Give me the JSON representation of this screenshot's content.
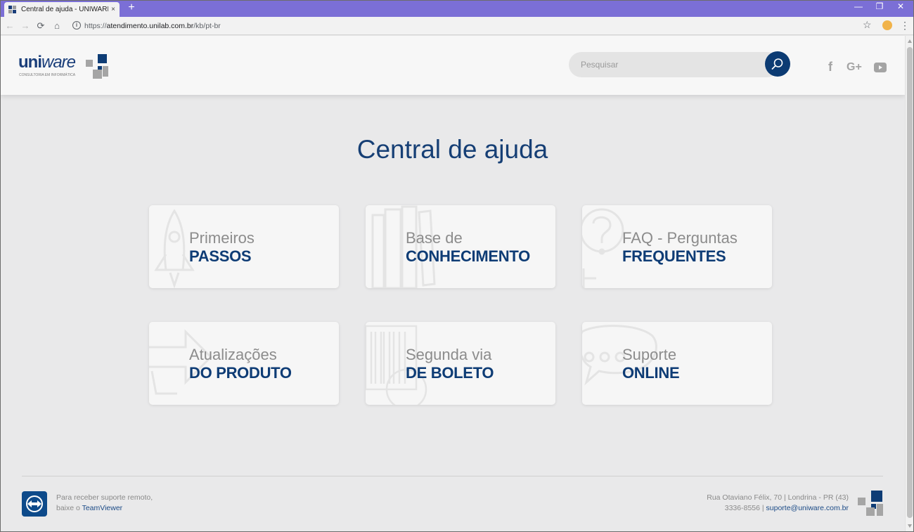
{
  "browser": {
    "tab_title": "Central de ajuda - UNIWARE CONSULTORIA",
    "tab_close": "×",
    "new_tab": "+",
    "url_prefix": "https://",
    "url_host": "atendimento.unilab.com.br",
    "url_path": "/kb/pt-br",
    "back": "←",
    "forward": "→",
    "reload": "⟳",
    "home": "⌂",
    "minimize": "—",
    "restore": "❐",
    "close": "✕",
    "bookmark": "☆",
    "menu": "⋮"
  },
  "header": {
    "logo_main": "uni",
    "logo_italic": "ware",
    "logo_tagline": "CONSULTORIA EM INFORMÁTICA",
    "search_placeholder": "Pesquisar",
    "social": [
      {
        "icon": "facebook-icon",
        "glyph": "f"
      },
      {
        "icon": "google-plus-icon",
        "glyph": "G+"
      },
      {
        "icon": "youtube-icon",
        "glyph": ""
      }
    ]
  },
  "main": {
    "title": "Central de ajuda",
    "cards": [
      {
        "line1": "Primeiros",
        "line2": "PASSOS",
        "icon": "rocket-icon"
      },
      {
        "line1": "Base de",
        "line2": "CONHECIMENTO",
        "icon": "books-icon"
      },
      {
        "line1": "FAQ - Perguntas",
        "line2": "FREQUENTES",
        "icon": "question-icon"
      },
      {
        "line1": "Atualizações",
        "line2": "DO PRODUTO",
        "icon": "arrow-icon"
      },
      {
        "line1": "Segunda via",
        "line2": "DE BOLETO",
        "icon": "barcode-icon"
      },
      {
        "line1": "Suporte",
        "line2": "ONLINE",
        "icon": "chat-icon"
      }
    ]
  },
  "footer": {
    "remote_line1": "Para receber suporte remoto,",
    "remote_line2_prefix": "baixe o ",
    "remote_link": "TeamViewer",
    "address_line1": "Rua Otaviano Félix, 70 | Londrina - PR (43)",
    "address_phone": "3336-8556 | ",
    "address_email": "suporte@uniware.com.br"
  },
  "colors": {
    "brand_navy": "#0e3c75",
    "brand_light": "#8c8c8c",
    "browser_titlebar": "#7b6fd6"
  }
}
